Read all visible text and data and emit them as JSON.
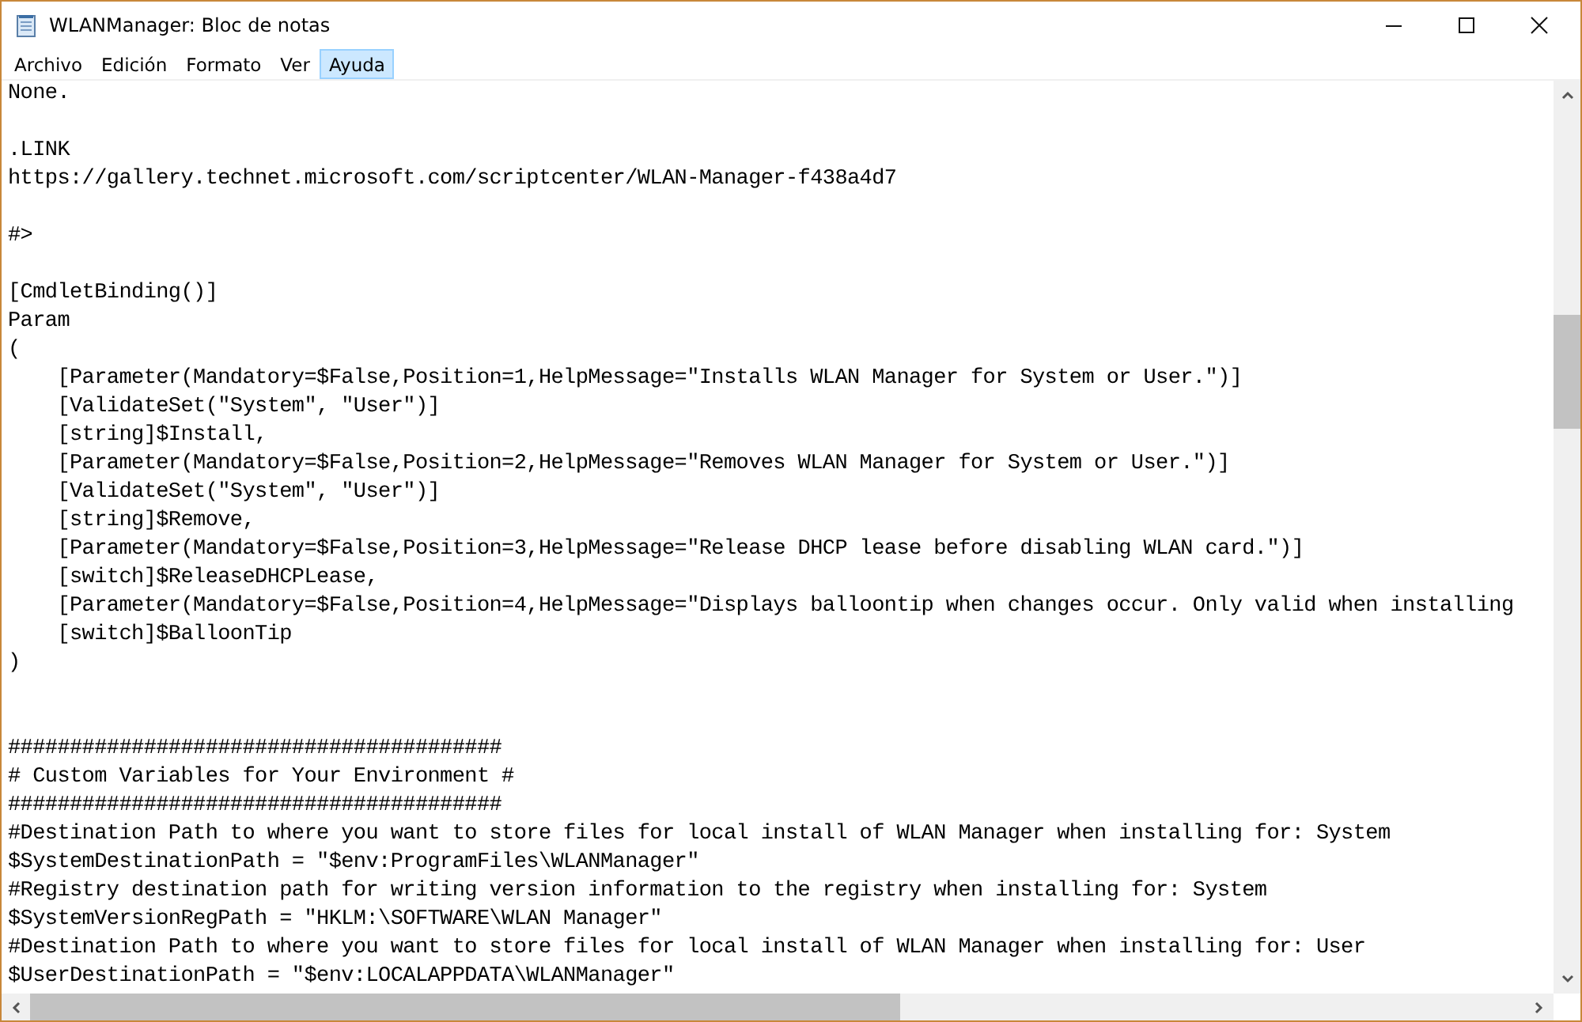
{
  "window": {
    "title": "WLANManager: Bloc de notas"
  },
  "menu": [
    {
      "label": "Archivo",
      "selected": false
    },
    {
      "label": "Edición",
      "selected": false
    },
    {
      "label": "Formato",
      "selected": false
    },
    {
      "label": "Ver",
      "selected": false
    },
    {
      "label": "Ayuda",
      "selected": true
    }
  ],
  "lines": [
    {
      "kind": "text",
      "text": "None."
    },
    {
      "kind": "blank"
    },
    {
      "kind": "text",
      "text": ".LINK"
    },
    {
      "kind": "text",
      "text": "https://gallery.technet.microsoft.com/scriptcenter/WLAN-Manager-f438a4d7"
    },
    {
      "kind": "blank"
    },
    {
      "kind": "text",
      "text": "#>"
    },
    {
      "kind": "blank"
    },
    {
      "kind": "text",
      "text": "[CmdletBinding()]"
    },
    {
      "kind": "text",
      "text": "Param"
    },
    {
      "kind": "text",
      "text": "("
    },
    {
      "kind": "text",
      "text": "    [Parameter(Mandatory=$False,Position=1,HelpMessage=\"Installs WLAN Manager for System or User.\")]"
    },
    {
      "kind": "text",
      "text": "    [ValidateSet(\"System\", \"User\")]"
    },
    {
      "kind": "text",
      "text": "    [string]$Install,"
    },
    {
      "kind": "text",
      "text": "    [Parameter(Mandatory=$False,Position=2,HelpMessage=\"Removes WLAN Manager for System or User.\")]"
    },
    {
      "kind": "text",
      "text": "    [ValidateSet(\"System\", \"User\")]"
    },
    {
      "kind": "text",
      "text": "    [string]$Remove,"
    },
    {
      "kind": "text",
      "text": "    [Parameter(Mandatory=$False,Position=3,HelpMessage=\"Release DHCP lease before disabling WLAN card.\")]"
    },
    {
      "kind": "text",
      "text": "    [switch]$ReleaseDHCPLease,"
    },
    {
      "kind": "text",
      "text": "    [Parameter(Mandatory=$False,Position=4,HelpMessage=\"Displays balloontip when changes occur. Only valid when installing"
    },
    {
      "kind": "text",
      "text": "    [switch]$BalloonTip"
    },
    {
      "kind": "text",
      "text": ")"
    },
    {
      "kind": "blank"
    },
    {
      "kind": "blank"
    },
    {
      "kind": "text",
      "text": "########################################"
    },
    {
      "kind": "text",
      "text": "# Custom Variables for Your Environment #"
    },
    {
      "kind": "text",
      "text": "########################################"
    },
    {
      "kind": "text",
      "text": "#Destination Path to where you want to store files for local install of WLAN Manager when installing for: System"
    },
    {
      "kind": "text",
      "text": "$SystemDestinationPath = \"$env:ProgramFiles\\WLANManager\""
    },
    {
      "kind": "text",
      "text": "#Registry destination path for writing version information to the registry when installing for: System"
    },
    {
      "kind": "text",
      "text": "$SystemVersionRegPath = \"HKLM:\\SOFTWARE\\WLAN Manager\""
    },
    {
      "kind": "text",
      "text": "#Destination Path to where you want to store files for local install of WLAN Manager when installing for: User"
    },
    {
      "kind": "text",
      "text": "$UserDestinationPath = \"$env:LOCALAPPDATA\\WLANManager\""
    }
  ]
}
